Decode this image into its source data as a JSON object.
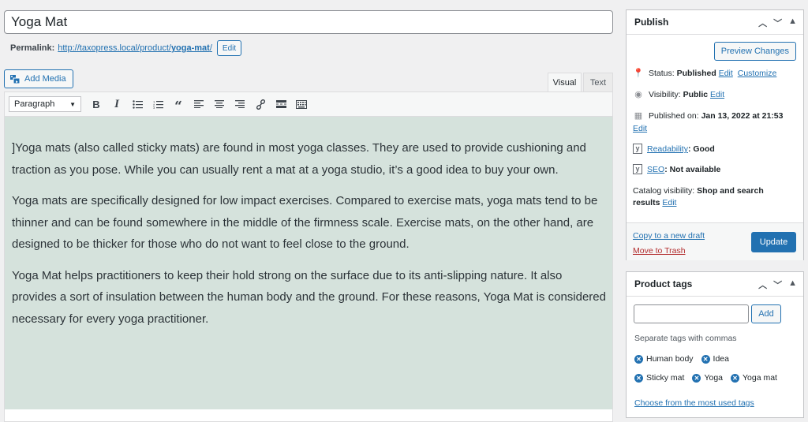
{
  "post": {
    "title": "Yoga Mat"
  },
  "permalink": {
    "label": "Permalink:",
    "url_prefix": "http://taxopress.local/product/",
    "slug": "yoga-mat",
    "url_suffix": "/",
    "edit_label": "Edit"
  },
  "media": {
    "add_label": "Add Media"
  },
  "editor_tabs": {
    "visual": "Visual",
    "text": "Text"
  },
  "toolbar": {
    "format_value": "Paragraph",
    "buttons": [
      "bold-icon",
      "italic-icon",
      "bulleted-list-icon",
      "numbered-list-icon",
      "blockquote-icon",
      "align-left-icon",
      "align-center-icon",
      "align-right-icon",
      "link-icon",
      "read-more-icon",
      "toolbar-toggle-icon"
    ]
  },
  "content": {
    "paragraphs": [
      "]Yoga mats (also called sticky mats) are found in most yoga classes. They are used to provide cushioning and traction as you pose. While you can usually rent a mat at a yoga studio, it’s a good idea to buy your own.",
      "Yoga mats are specifically designed for low impact exercises. Compared to exercise mats, yoga mats tend to be thinner and can be found somewhere in the middle of the firmness scale. Exercise mats, on the other hand, are designed to be thicker for those who do not want to feel close to the ground.",
      "Yoga Mat helps practitioners to keep their hold strong on the surface due to its anti-slipping nature. It also provides a sort of insulation between the human body and the ground. For these reasons, Yoga Mat is considered necessary for every yoga practitioner."
    ]
  },
  "publish": {
    "title": "Publish",
    "preview_label": "Preview Changes",
    "status_label": "Status:",
    "status_value": "Published",
    "status_edit": "Edit",
    "status_customize": "Customize",
    "visibility_label": "Visibility:",
    "visibility_value": "Public",
    "visibility_edit": "Edit",
    "published_label": "Published on:",
    "published_value": "Jan 13, 2022 at 21:53",
    "published_edit": "Edit",
    "readability_link": "Readability",
    "readability_value": ": Good",
    "seo_link": "SEO",
    "seo_value": ": Not available",
    "catalog_label": "Catalog visibility:",
    "catalog_value": "Shop and search results",
    "catalog_edit": "Edit",
    "copy_draft": "Copy to a new draft",
    "trash": "Move to Trash",
    "update": "Update"
  },
  "product_tags": {
    "title": "Product tags",
    "input_value": "",
    "add_label": "Add",
    "hint": "Separate tags with commas",
    "row1": [
      "Human body",
      "Idea"
    ],
    "row2": [
      "Sticky mat",
      "Yoga",
      "Yoga mat"
    ],
    "choose_link": "Choose from the most used tags"
  },
  "colors": {
    "accent": "#2271b1",
    "content_bg": "#d5e2dc",
    "trash": "#b32d2e"
  }
}
